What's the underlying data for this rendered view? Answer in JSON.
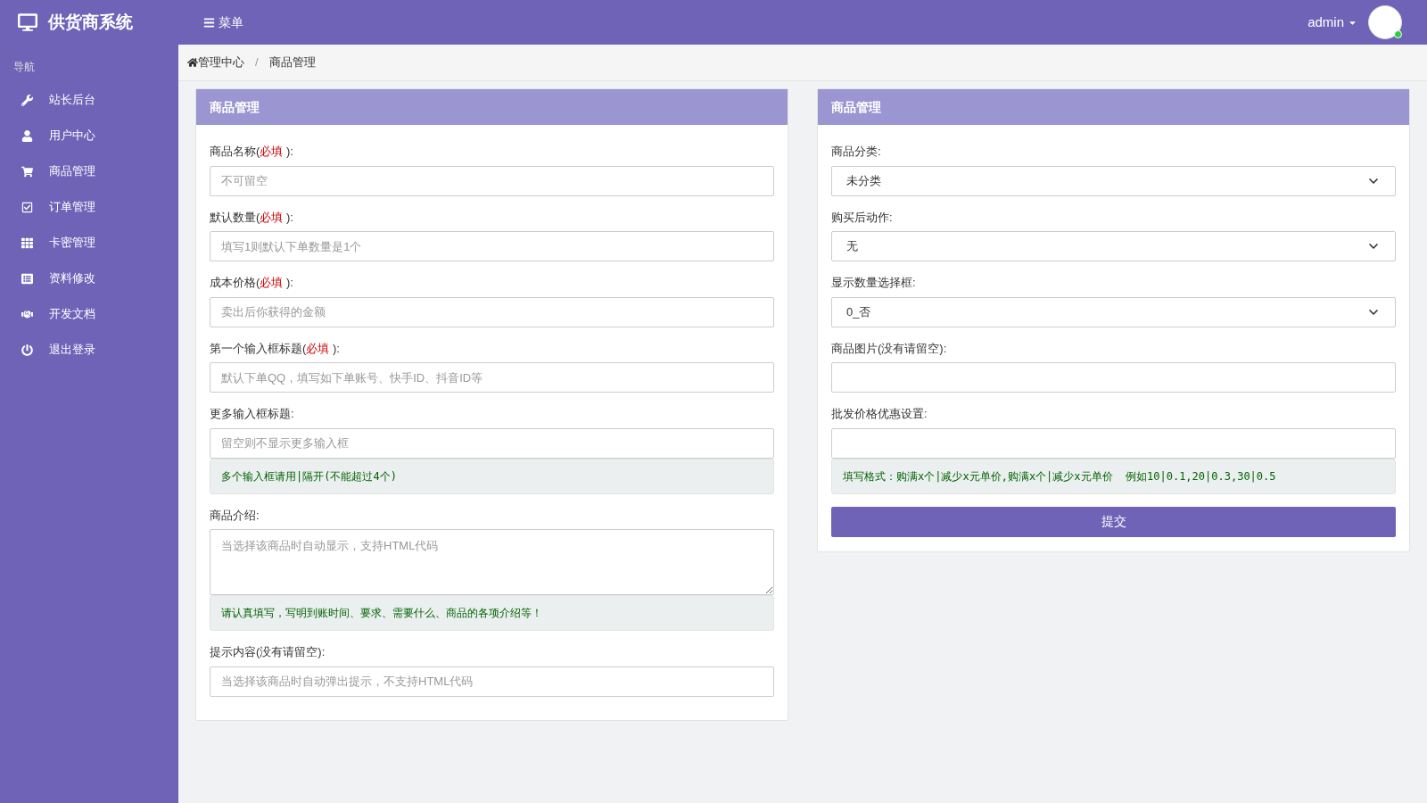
{
  "brand": {
    "title": "供货商系统"
  },
  "topbar": {
    "menu_label": "菜单",
    "user": "admin"
  },
  "sidebar": {
    "heading": "导航",
    "items": [
      {
        "label": "站长后台"
      },
      {
        "label": "用户中心"
      },
      {
        "label": "商品管理"
      },
      {
        "label": "订单管理"
      },
      {
        "label": "卡密管理"
      },
      {
        "label": "资料修改"
      },
      {
        "label": "开发文档"
      },
      {
        "label": "退出登录"
      }
    ]
  },
  "breadcrumb": [
    "管理中心",
    "商品管理"
  ],
  "breadcrumb_separator": "/",
  "panels": [
    {
      "title": "商品管理",
      "fields": [
        {
          "kind": "input",
          "label": "商品名称(",
          "required": "必填",
          "label_end": " ):",
          "placeholder": "不可留空"
        },
        {
          "kind": "input",
          "label": "默认数量(",
          "required": "必填",
          "label_end": " ):",
          "placeholder": "填写1则默认下单数量是1个"
        },
        {
          "kind": "input",
          "label": "成本价格(",
          "required": "必填",
          "label_end": " ):",
          "placeholder": "卖出后你获得的金额"
        },
        {
          "kind": "input",
          "label": "第一个输入框标题(",
          "required": "必填",
          "label_end": " ):",
          "placeholder": "默认下单QQ，填写如下单账号、快手ID、抖音ID等"
        },
        {
          "kind": "input",
          "label": "更多输入框标题:",
          "placeholder": "留空则不显示更多输入框",
          "help": "多个输入框请用|隔开(不能超过4个)"
        },
        {
          "kind": "textarea",
          "label": "商品介绍:",
          "placeholder": "当选择该商品时自动显示，支持HTML代码",
          "help": "请认真填写，写明到账时间、要求、需要什么、商品的各项介绍等！"
        },
        {
          "kind": "input",
          "label": "提示内容(没有请留空):",
          "placeholder": "当选择该商品时自动弹出提示，不支持HTML代码"
        }
      ]
    },
    {
      "title": "商品管理",
      "fields": [
        {
          "kind": "select",
          "label": "商品分类:",
          "value": "未分类"
        },
        {
          "kind": "select",
          "label": "购买后动作:",
          "value": "无"
        },
        {
          "kind": "select",
          "label": "显示数量选择框:",
          "value": "0_否"
        },
        {
          "kind": "input",
          "label": "商品图片(没有请留空):"
        },
        {
          "kind": "input",
          "label": "批发价格优惠设置:",
          "help": "填写格式：购满x个|减少x元单价,购满x个|减少x元单价  例如10|0.1,20|0.3,30|0.5"
        }
      ],
      "submit": "提交"
    }
  ]
}
